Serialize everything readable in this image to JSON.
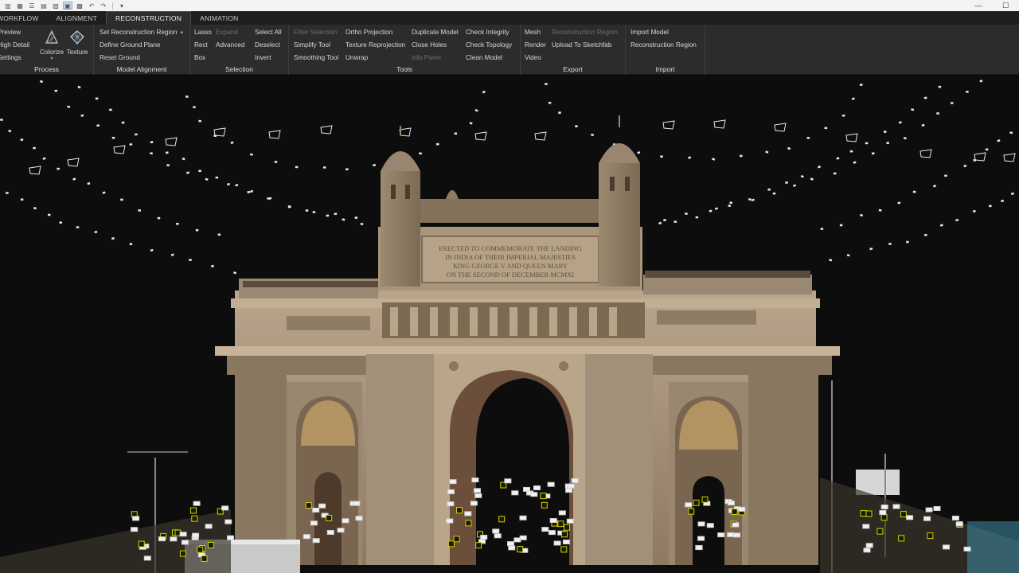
{
  "window": {
    "title": "",
    "controls": [
      {
        "name": "minimize",
        "glyph": "—"
      },
      {
        "name": "maximize",
        "glyph": "☐"
      }
    ]
  },
  "tabs": [
    {
      "label": "WORKFLOW",
      "active": false
    },
    {
      "label": "ALIGNMENT",
      "active": false
    },
    {
      "label": "RECONSTRUCTION",
      "active": true
    },
    {
      "label": "ANIMATION",
      "active": false
    }
  ],
  "ribbon": {
    "process": {
      "label": "Process",
      "items": [
        "Preview",
        "High Detail",
        "Settings"
      ],
      "colorize": "Colorize",
      "texture": "Texture"
    },
    "model_alignment": {
      "label": "Model Alignment",
      "items": [
        "Set Reconstruction Region",
        "Define Ground Plane",
        "Reset Ground"
      ]
    },
    "selection": {
      "label": "Selection",
      "col1": [
        "Lasso",
        "Rect",
        "Box"
      ],
      "col2": [
        "Expand",
        "Advanced"
      ],
      "col3": [
        "Select All",
        "Deselect",
        "Invert"
      ]
    },
    "tools": {
      "label": "Tools",
      "col1": [
        "Filter Selection",
        "Simplify Tool",
        "Smoothing Tool"
      ],
      "col2": [
        "Ortho Projection",
        "Texture Reprojection",
        "Unwrap"
      ],
      "col3": [
        "Duplicate Model",
        "Close Holes",
        "Info Panel"
      ],
      "col4": [
        "Check Integrity",
        "Check Topology",
        "Clean Model"
      ]
    },
    "export": {
      "label": "Export",
      "col1": [
        "Mesh",
        "Render",
        "Video"
      ],
      "col2": [
        "Reconstruction Region",
        "Upload To Sketchfab"
      ]
    },
    "import": {
      "label": "Import",
      "items": [
        "Import Model",
        "Reconstruction Region"
      ]
    }
  },
  "viewport": {
    "inscription": [
      "ERECTED TO COMMEMORATE THE LANDING",
      "IN INDIA OF THEIR IMPERIAL MAJESTIES",
      "KING GEORGE V AND QUEEN MARY",
      "ON THE SECOND OF DECEMBER MCMXI"
    ],
    "colors": {
      "background": "#0d0d0d",
      "stone": "#a8937a",
      "stone_dark": "#6e5c48",
      "camera": "#e8e8e8",
      "marker": "#d4d400"
    }
  }
}
